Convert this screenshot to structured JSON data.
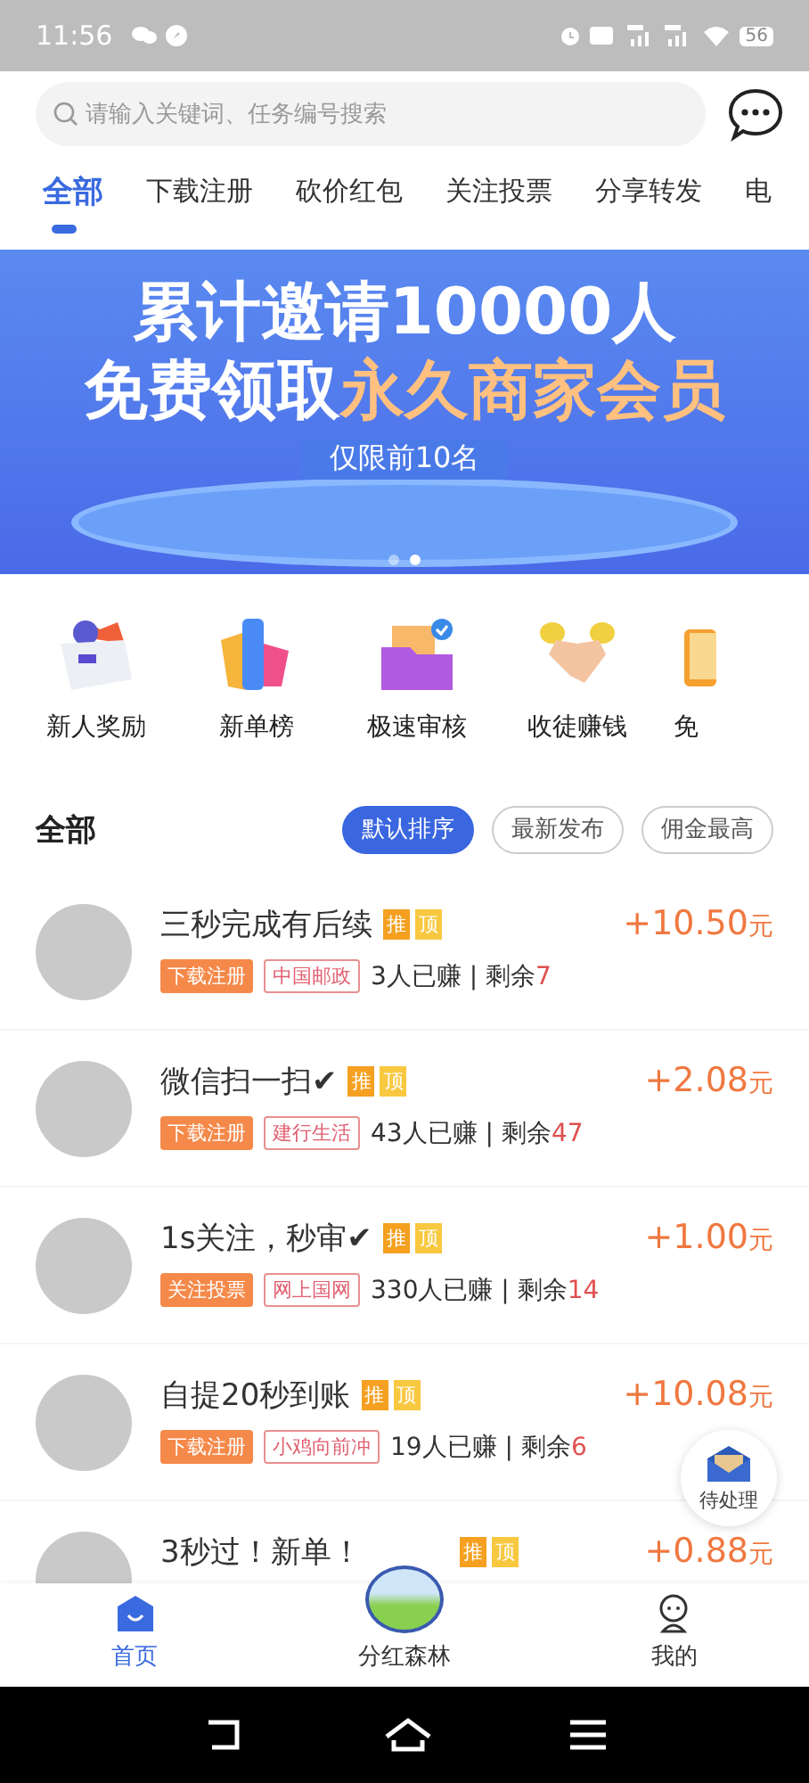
{
  "status_bar": {
    "time": "11:56",
    "battery": "56"
  },
  "search": {
    "placeholder": "请输入关键词、任务编号搜索"
  },
  "tabs": [
    {
      "label": "全部",
      "selected": true
    },
    {
      "label": "下载注册",
      "selected": false
    },
    {
      "label": "砍价红包",
      "selected": false
    },
    {
      "label": "关注投票",
      "selected": false
    },
    {
      "label": "分享转发",
      "selected": false
    },
    {
      "label": "电",
      "selected": false
    }
  ],
  "banner": {
    "line_1": "累计邀请10000人",
    "line_2_start": "免费领取",
    "line_2_highlight": "永久商家会员",
    "note": "仅限前10名",
    "dots": [
      {
        "selected": false
      },
      {
        "selected": true
      }
    ]
  },
  "shortcuts": [
    {
      "label": "新人奖励",
      "kind": "box"
    },
    {
      "label": "新单榜",
      "kind": "podium"
    },
    {
      "label": "极速审核",
      "kind": "folder"
    },
    {
      "label": "收徒赚钱",
      "kind": "handshake"
    },
    {
      "label": "免",
      "kind": "notes"
    }
  ],
  "section": {
    "title": "全部",
    "sorts": [
      {
        "label": "默认排序",
        "selected": true
      },
      {
        "label": "最新发布",
        "selected": false
      },
      {
        "label": "佣金最高",
        "selected": false
      }
    ]
  },
  "tasks": [
    {
      "title": "三秒完成有后续",
      "badges": [
        "推",
        "顶"
      ],
      "category": "下载注册",
      "merchant": "中国邮政",
      "earned": "3人已赚 | 剩余",
      "remaining": "7",
      "price": "+10.50",
      "unit": "元"
    },
    {
      "title": "微信扫一扫✔",
      "badges": [
        "推",
        "顶"
      ],
      "category": "下载注册",
      "merchant": "建行生活",
      "earned": "43人已赚 | 剩余",
      "remaining": "47",
      "price": "+2.08",
      "unit": "元"
    },
    {
      "title": "1s关注，秒审✔",
      "badges": [
        "推",
        "顶"
      ],
      "category": "关注投票",
      "merchant": "网上国网",
      "earned": "330人已赚 | 剩余",
      "remaining": "14",
      "price": "+1.00",
      "unit": "元"
    },
    {
      "title": "自提20秒到账",
      "badges": [
        "推",
        "顶"
      ],
      "category": "下载注册",
      "merchant": "小鸡向前冲",
      "earned": "19人已赚 | 剩余",
      "remaining": "6",
      "price": "+10.08",
      "unit": "元"
    },
    {
      "title": "3秒过！新单！",
      "badges": [
        "推",
        "顶"
      ],
      "price": "+0.88",
      "unit": "元"
    }
  ],
  "floating_button": {
    "label": "待处理"
  },
  "bottom_nav": [
    {
      "label": "首页",
      "kind": "home",
      "selected": true
    },
    {
      "label": "分红森林",
      "kind": "forest",
      "selected": false
    },
    {
      "label": "我的",
      "kind": "profile",
      "selected": false
    }
  ]
}
